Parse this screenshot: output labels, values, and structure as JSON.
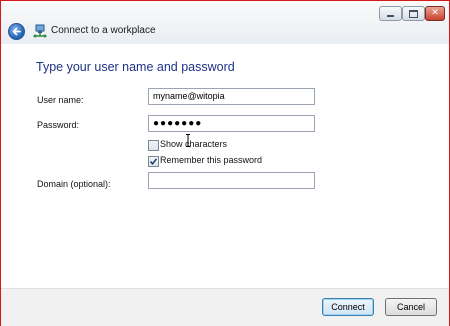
{
  "window": {
    "title": "Connect to a workplace",
    "caption_buttons": {
      "minimize": "minimize",
      "maximize": "maximize",
      "close": "✕"
    }
  },
  "content": {
    "heading": "Type your user name and password",
    "username": {
      "label": "User name:",
      "value": "myname@witopia"
    },
    "password": {
      "label": "Password:",
      "value": "●●●●●●●"
    },
    "show_characters": {
      "label": "Show characters",
      "checked": false
    },
    "remember_password": {
      "label": "Remember this password",
      "checked": true
    },
    "domain": {
      "label": "Domain (optional):",
      "value": ""
    }
  },
  "footer": {
    "connect_label": "Connect",
    "cancel_label": "Cancel"
  },
  "icons": {
    "back": "back-arrow-icon",
    "network": "network-connection-icon",
    "checkmark": "checkmark-icon"
  },
  "colors": {
    "heading": "#1e3287",
    "window_border": "#d21a1a",
    "close_button": "#c9422c"
  }
}
